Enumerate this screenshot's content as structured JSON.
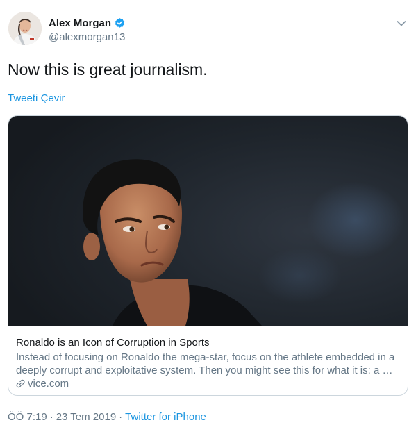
{
  "author": {
    "name": "Alex Morgan",
    "handle": "@alexmorgan13",
    "avatar": "avatar-photo",
    "verified_icon": "verified-badge-icon",
    "accent_color": "#1da1f2"
  },
  "tweet": {
    "text": "Now this is great journalism.",
    "translate_label": "Tweeti Çevir"
  },
  "card": {
    "image": "ronaldo-photo",
    "title": "Ronaldo is an Icon of Corruption in Sports",
    "description": "Instead of focusing on Ronaldo the mega-star, focus on the athlete embedded in a deeply corrupt and exploitative system. Then you might see this for what it is: a …",
    "domain": "vice.com",
    "link_icon": "link-icon"
  },
  "meta": {
    "time": "ÖÖ 7:19",
    "separator": "·",
    "date": "23 Tem 2019",
    "source": "Twitter for iPhone"
  },
  "icons": {
    "menu": "chevron-down-icon"
  },
  "colors": {
    "link": "#1b95e0",
    "secondary_text": "#657786",
    "border": "#ccd6dd"
  }
}
